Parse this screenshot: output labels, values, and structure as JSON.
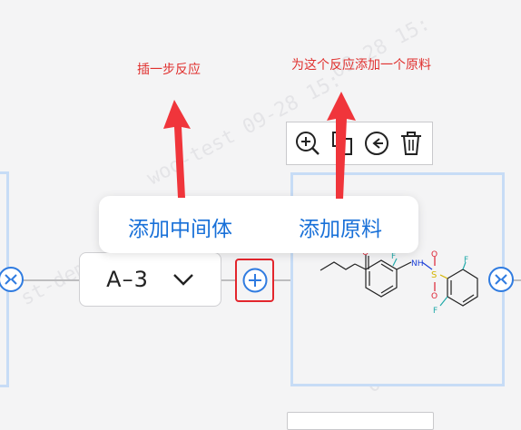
{
  "annotations": {
    "insert_step": "插一步反应",
    "add_raw_material": "为这个反应添加一个原料"
  },
  "popup": {
    "add_intermediate": "添加中间体",
    "add_raw_material": "添加原料"
  },
  "step_selector": {
    "label": "A–3"
  },
  "toolbar": {
    "icons": [
      "zoom-in-icon",
      "copy-icon",
      "collapse-icon",
      "delete-icon"
    ]
  },
  "structure": {
    "atom_labels": [
      "O",
      "F",
      "NH",
      "S",
      "O",
      "O",
      "F",
      "F"
    ]
  },
  "colors": {
    "accent": "#1870d8",
    "annotation": "#e0312f",
    "highlight_border": "#e3262d",
    "card_border": "#c7dcf6"
  }
}
